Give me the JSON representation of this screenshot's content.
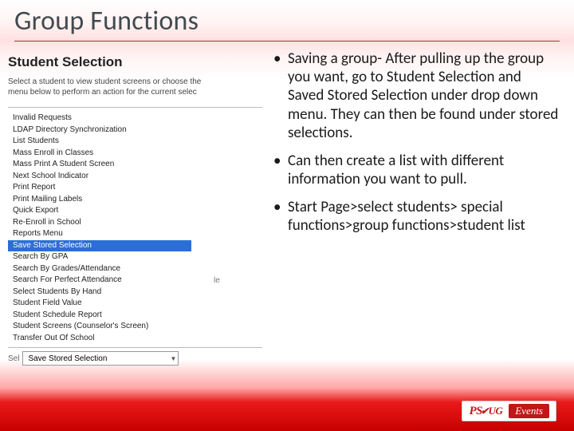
{
  "title": "Group Functions",
  "left": {
    "heading": "Student Selection",
    "instruction": "Select a student to view student screens or choose the\nmenu below to perform an action for the current selec",
    "list_items": [
      "Invalid Requests",
      "LDAP Directory Synchronization",
      "List Students",
      "Mass Enroll in Classes",
      "Mass Print A Student Screen",
      "Next School Indicator",
      "Print Report",
      "Print Mailing Labels",
      "Quick Export",
      "Re-Enroll in School",
      "Reports Menu",
      "Save Stored Selection",
      "Search By GPA",
      "Search By Grades/Attendance",
      "Search For Perfect Attendance",
      "Select Students By Hand",
      "Student Field Value",
      "Student Schedule Report",
      "Student Screens (Counselor's Screen)",
      "Transfer Out Of School"
    ],
    "highlight_index": 11,
    "select_label": "Sel",
    "dropdown_value": "Save Stored Selection",
    "stray_text": "le"
  },
  "bullets": [
    "Saving a group- After pulling up the group you want, go to Student Selection and Saved Stored Selection under drop down menu. They can then be found under stored selections.",
    "Can then create a list with different information you want to pull.",
    "Start Page>select students> special functions>group functions>student list"
  ],
  "footer": {
    "logo_left": "PS",
    "logo_right": "UG",
    "badge": "Events"
  }
}
